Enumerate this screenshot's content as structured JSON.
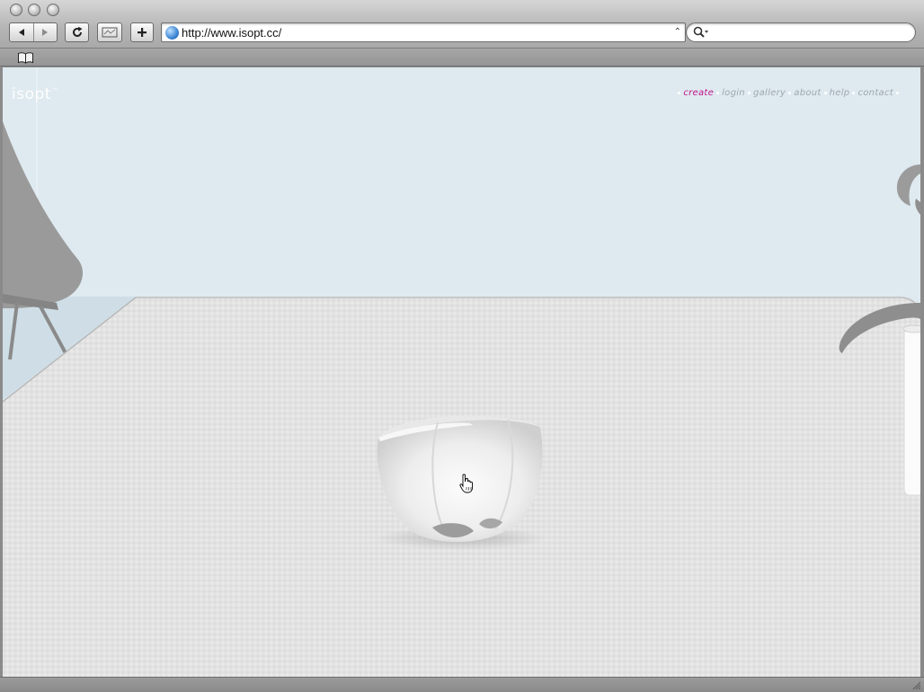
{
  "browser": {
    "address_url": "http://www.isopt.cc/",
    "search_placeholder": "",
    "icons": {
      "back": "back-arrow-icon",
      "forward": "forward-arrow-icon",
      "reload": "reload-icon",
      "bookmark": "add-bookmark-icon",
      "add": "plus-icon",
      "site": "globe-icon",
      "search": "magnifier-icon",
      "bookmarks_bar": "book-icon"
    }
  },
  "site": {
    "logo": "isopt",
    "logo_mark": "™",
    "nav": [
      {
        "label": "create",
        "active": true
      },
      {
        "label": "login",
        "active": false
      },
      {
        "label": "gallery",
        "active": false
      },
      {
        "label": "about",
        "active": false
      },
      {
        "label": "help",
        "active": false
      },
      {
        "label": "contact",
        "active": false
      }
    ]
  },
  "colors": {
    "wall": "#deeaf0",
    "table": "#e6e6e6",
    "nav_active": "#c0138a",
    "nav_inactive": "#9ea7ad"
  }
}
